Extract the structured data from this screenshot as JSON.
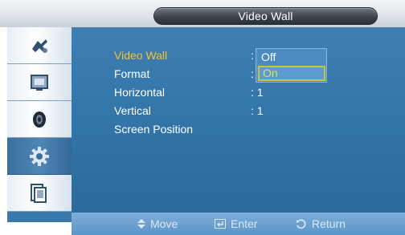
{
  "header": {
    "title": "Video Wall"
  },
  "sidebar": {
    "items": [
      {
        "icon": "picture-icon"
      },
      {
        "icon": "display-screen-icon"
      },
      {
        "icon": "speaker-icon"
      },
      {
        "icon": "gear-icon",
        "active": true
      },
      {
        "icon": "multi-window-icon"
      }
    ]
  },
  "menu": {
    "rows": [
      {
        "label": "Video Wall",
        "value": ":"
      },
      {
        "label": "Format",
        "value": ":"
      },
      {
        "label": "Horizontal",
        "value": ": 1"
      },
      {
        "label": "Vertical",
        "value": ": 1"
      },
      {
        "label": "Screen Position",
        "value": ""
      }
    ]
  },
  "dropdown": {
    "options": [
      "Off",
      "On"
    ],
    "highlighted": "On"
  },
  "footer": {
    "move": "Move",
    "enter": "Enter",
    "return": "Return"
  },
  "colors": {
    "panel_blue": "#3275a9",
    "highlight_yellow": "#f3c233",
    "sidebar_active": "#4f87b5"
  }
}
